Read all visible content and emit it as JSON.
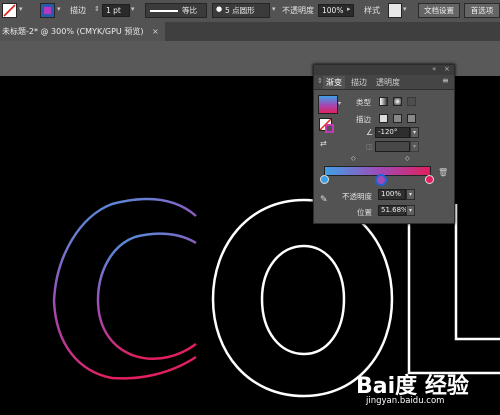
{
  "control_bar": {
    "stroke_label": "描边",
    "stroke_weight": "1 pt",
    "stroke_profile": "等比",
    "brush": "5 点圆形",
    "opacity_label": "不透明度",
    "opacity_value": "100%",
    "style_label": "样式",
    "doc_settings_button": "文档设置",
    "prefs_button": "首选项"
  },
  "document": {
    "tab_title": "未标题-2* @ 300% (CMYK/GPU 预览)",
    "close_glyph": "×"
  },
  "gradient_panel": {
    "tabs": [
      {
        "label": "渐变",
        "active": true
      },
      {
        "label": "描边",
        "active": false
      },
      {
        "label": "透明度",
        "active": false
      }
    ],
    "type_label": "类型",
    "stroke_label": "描边",
    "angle_value": "-120°",
    "opacity_label": "不透明度",
    "opacity_value": "100%",
    "location_label": "位置",
    "location_value": "51.68%",
    "gradient_colors": [
      "#3fa0e6",
      "#a04bb5",
      "#e0205f"
    ]
  },
  "artwork": {
    "gradient_colors": [
      "#3fa0e6",
      "#a04bb5",
      "#e0205f"
    ],
    "stroke_color": "#ffffff"
  },
  "watermark": {
    "brand_text": "Bai度 经验",
    "url_text": "jingyan.baidu.com"
  }
}
